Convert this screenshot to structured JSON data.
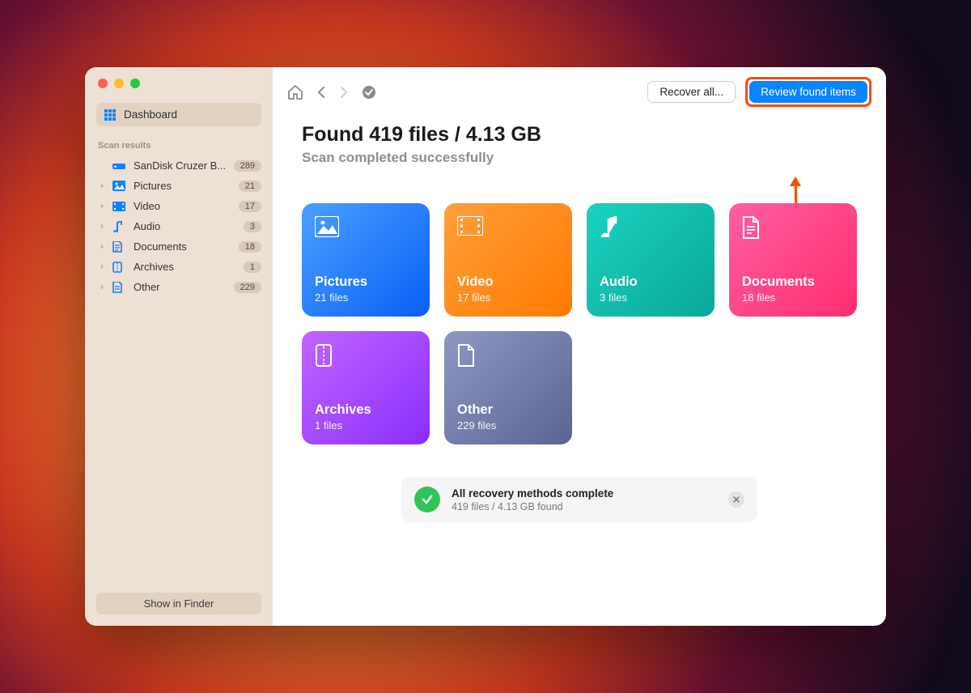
{
  "sidebar": {
    "dashboard_label": "Dashboard",
    "section_label": "Scan results",
    "device": {
      "label": "SanDisk Cruzer B...",
      "count": "289"
    },
    "items": [
      {
        "label": "Pictures",
        "count": "21"
      },
      {
        "label": "Video",
        "count": "17"
      },
      {
        "label": "Audio",
        "count": "3"
      },
      {
        "label": "Documents",
        "count": "18"
      },
      {
        "label": "Archives",
        "count": "1"
      },
      {
        "label": "Other",
        "count": "229"
      }
    ],
    "finder_label": "Show in Finder"
  },
  "toolbar": {
    "recover_label": "Recover all...",
    "review_label": "Review found items"
  },
  "heading": {
    "title": "Found 419 files / 4.13 GB",
    "subtitle": "Scan completed successfully"
  },
  "cards": [
    {
      "title": "Pictures",
      "sub": "21 files"
    },
    {
      "title": "Video",
      "sub": "17 files"
    },
    {
      "title": "Audio",
      "sub": "3 files"
    },
    {
      "title": "Documents",
      "sub": "18 files"
    },
    {
      "title": "Archives",
      "sub": "1 files"
    },
    {
      "title": "Other",
      "sub": "229 files"
    }
  ],
  "status": {
    "title": "All recovery methods complete",
    "subtitle": "419 files / 4.13 GB found"
  }
}
